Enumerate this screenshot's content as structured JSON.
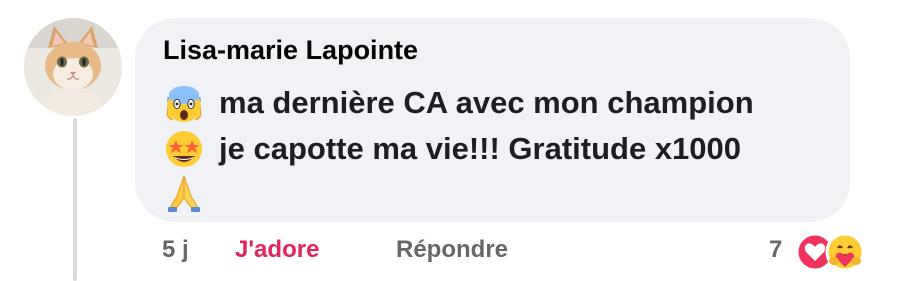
{
  "comment": {
    "author": "Lisa-marie Lapointe",
    "lines": [
      {
        "emoji": "screaming-face-icon",
        "text": "ma dernière CA avec mon champion"
      },
      {
        "emoji": "star-struck-face-icon",
        "text": "je capotte ma vie!!! Gratitude x1000"
      },
      {
        "emoji": "folded-hands-icon",
        "text": ""
      }
    ]
  },
  "actions": {
    "time": "5 j",
    "reaction_label": "J'adore",
    "reply_label": "Répondre",
    "reaction_count": "7",
    "reaction_icons": [
      "heart-reaction-icon",
      "care-reaction-icon"
    ],
    "reaction_label_color": "#e0245e"
  }
}
